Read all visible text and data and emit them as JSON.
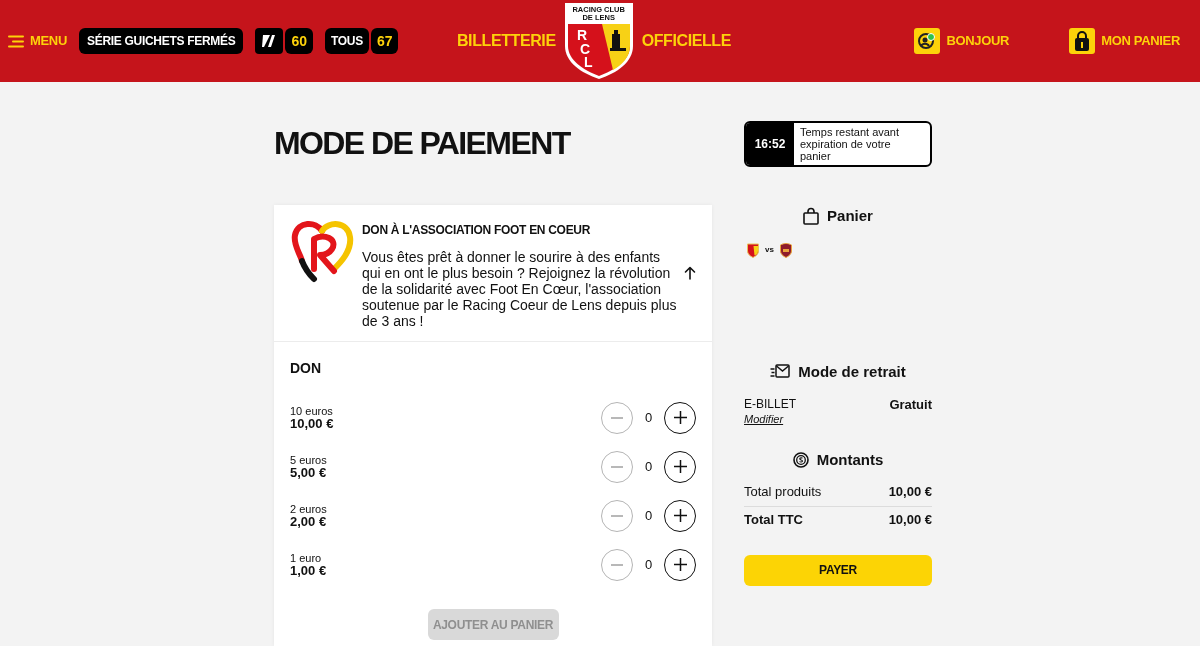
{
  "header": {
    "menu": {
      "label": "MENU"
    },
    "series": {
      "label": "SÉRIE GUICHETS FERMÉS"
    },
    "counters": [
      {
        "kind": "logo",
        "value": "60"
      },
      {
        "kind": "text",
        "label": "TOUS",
        "value": "67"
      }
    ],
    "title_left": "BILLETTERIE",
    "crest": {
      "banner": "RACING CLUB DE LENS",
      "initials": "RCL"
    },
    "title_right": "OFFICIELLE",
    "account": {
      "label": "BONJOUR"
    },
    "cart": {
      "label": "MON PANIER"
    }
  },
  "page": {
    "title": "MODE DE PAIEMENT"
  },
  "donation_card": {
    "title": "DON À L'ASSOCIATION FOOT EN COEUR",
    "description": "Vous êtes prêt à donner le sourire à des enfants qui en ont le plus besoin ? Rejoignez la révolution de la solidarité avec Foot En Cœur, l'association soutenue par le Racing Coeur de Lens depuis plus de 3 ans !",
    "expanded": true
  },
  "don": {
    "title": "DON",
    "items": [
      {
        "label": "10 euros",
        "price": "10,00 €",
        "quantity": "0",
        "decrement_disabled": true
      },
      {
        "label": "5 euros",
        "price": "5,00 €",
        "quantity": "0",
        "decrement_disabled": true
      },
      {
        "label": "2 euros",
        "price": "2,00 €",
        "quantity": "0",
        "decrement_disabled": true
      },
      {
        "label": "1 euro",
        "price": "1,00 €",
        "quantity": "0",
        "decrement_disabled": true
      }
    ],
    "add_button": {
      "label": "AJOUTER AU PANIER",
      "disabled": true
    }
  },
  "timer": {
    "time": "16:52",
    "text": "Temps restant avant expiration de votre panier"
  },
  "cart": {
    "title": "Panier",
    "match": {
      "separator": "vs"
    }
  },
  "delivery": {
    "title": "Mode de retrait",
    "method": "E-BILLET",
    "price": "Gratuit",
    "link": "Modifier"
  },
  "amounts": {
    "title": "Montants",
    "rows": [
      {
        "kind": "subtotal",
        "label": "Total produits",
        "value": "10,00 €"
      },
      {
        "kind": "total",
        "label": "Total TTC",
        "value": "10,00 €"
      }
    ]
  },
  "pay_button": {
    "label": "PAYER"
  }
}
